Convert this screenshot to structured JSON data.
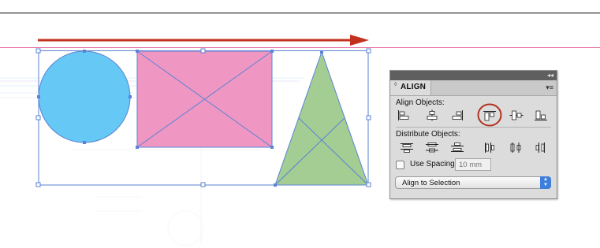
{
  "panel": {
    "tab_arrows": "◊",
    "tab_title": "ALIGN",
    "collapse_glyph": "◂◂",
    "menu_glyph": "▾≡",
    "align_objects_label": "Align Objects:",
    "distribute_objects_label": "Distribute Objects:",
    "use_spacing_label": "Use Spacing",
    "use_spacing_checked": false,
    "spacing_value": "10 mm",
    "align_to_value": "Align to Selection",
    "align_buttons": [
      "align-left-edges-icon",
      "align-horizontal-centers-icon",
      "align-right-edges-icon",
      "align-top-edges-icon",
      "align-vertical-centers-icon",
      "align-bottom-edges-icon"
    ],
    "distribute_buttons": [
      "distribute-top-edges-icon",
      "distribute-vertical-centers-icon",
      "distribute-bottom-edges-icon",
      "distribute-left-edges-icon",
      "distribute-horizontal-centers-icon",
      "distribute-right-edges-icon"
    ],
    "highlighted_button": "align-top-edges-icon"
  },
  "canvas": {
    "colors": {
      "circle_fill": "#66c8f4",
      "rectangle_fill": "#ef97c2",
      "triangle_fill": "#a3cd93",
      "selection": "#5a82d6",
      "arrow": "#c4301e",
      "guide": "#e36b9f",
      "highlight_circle": "#b0321f"
    }
  }
}
